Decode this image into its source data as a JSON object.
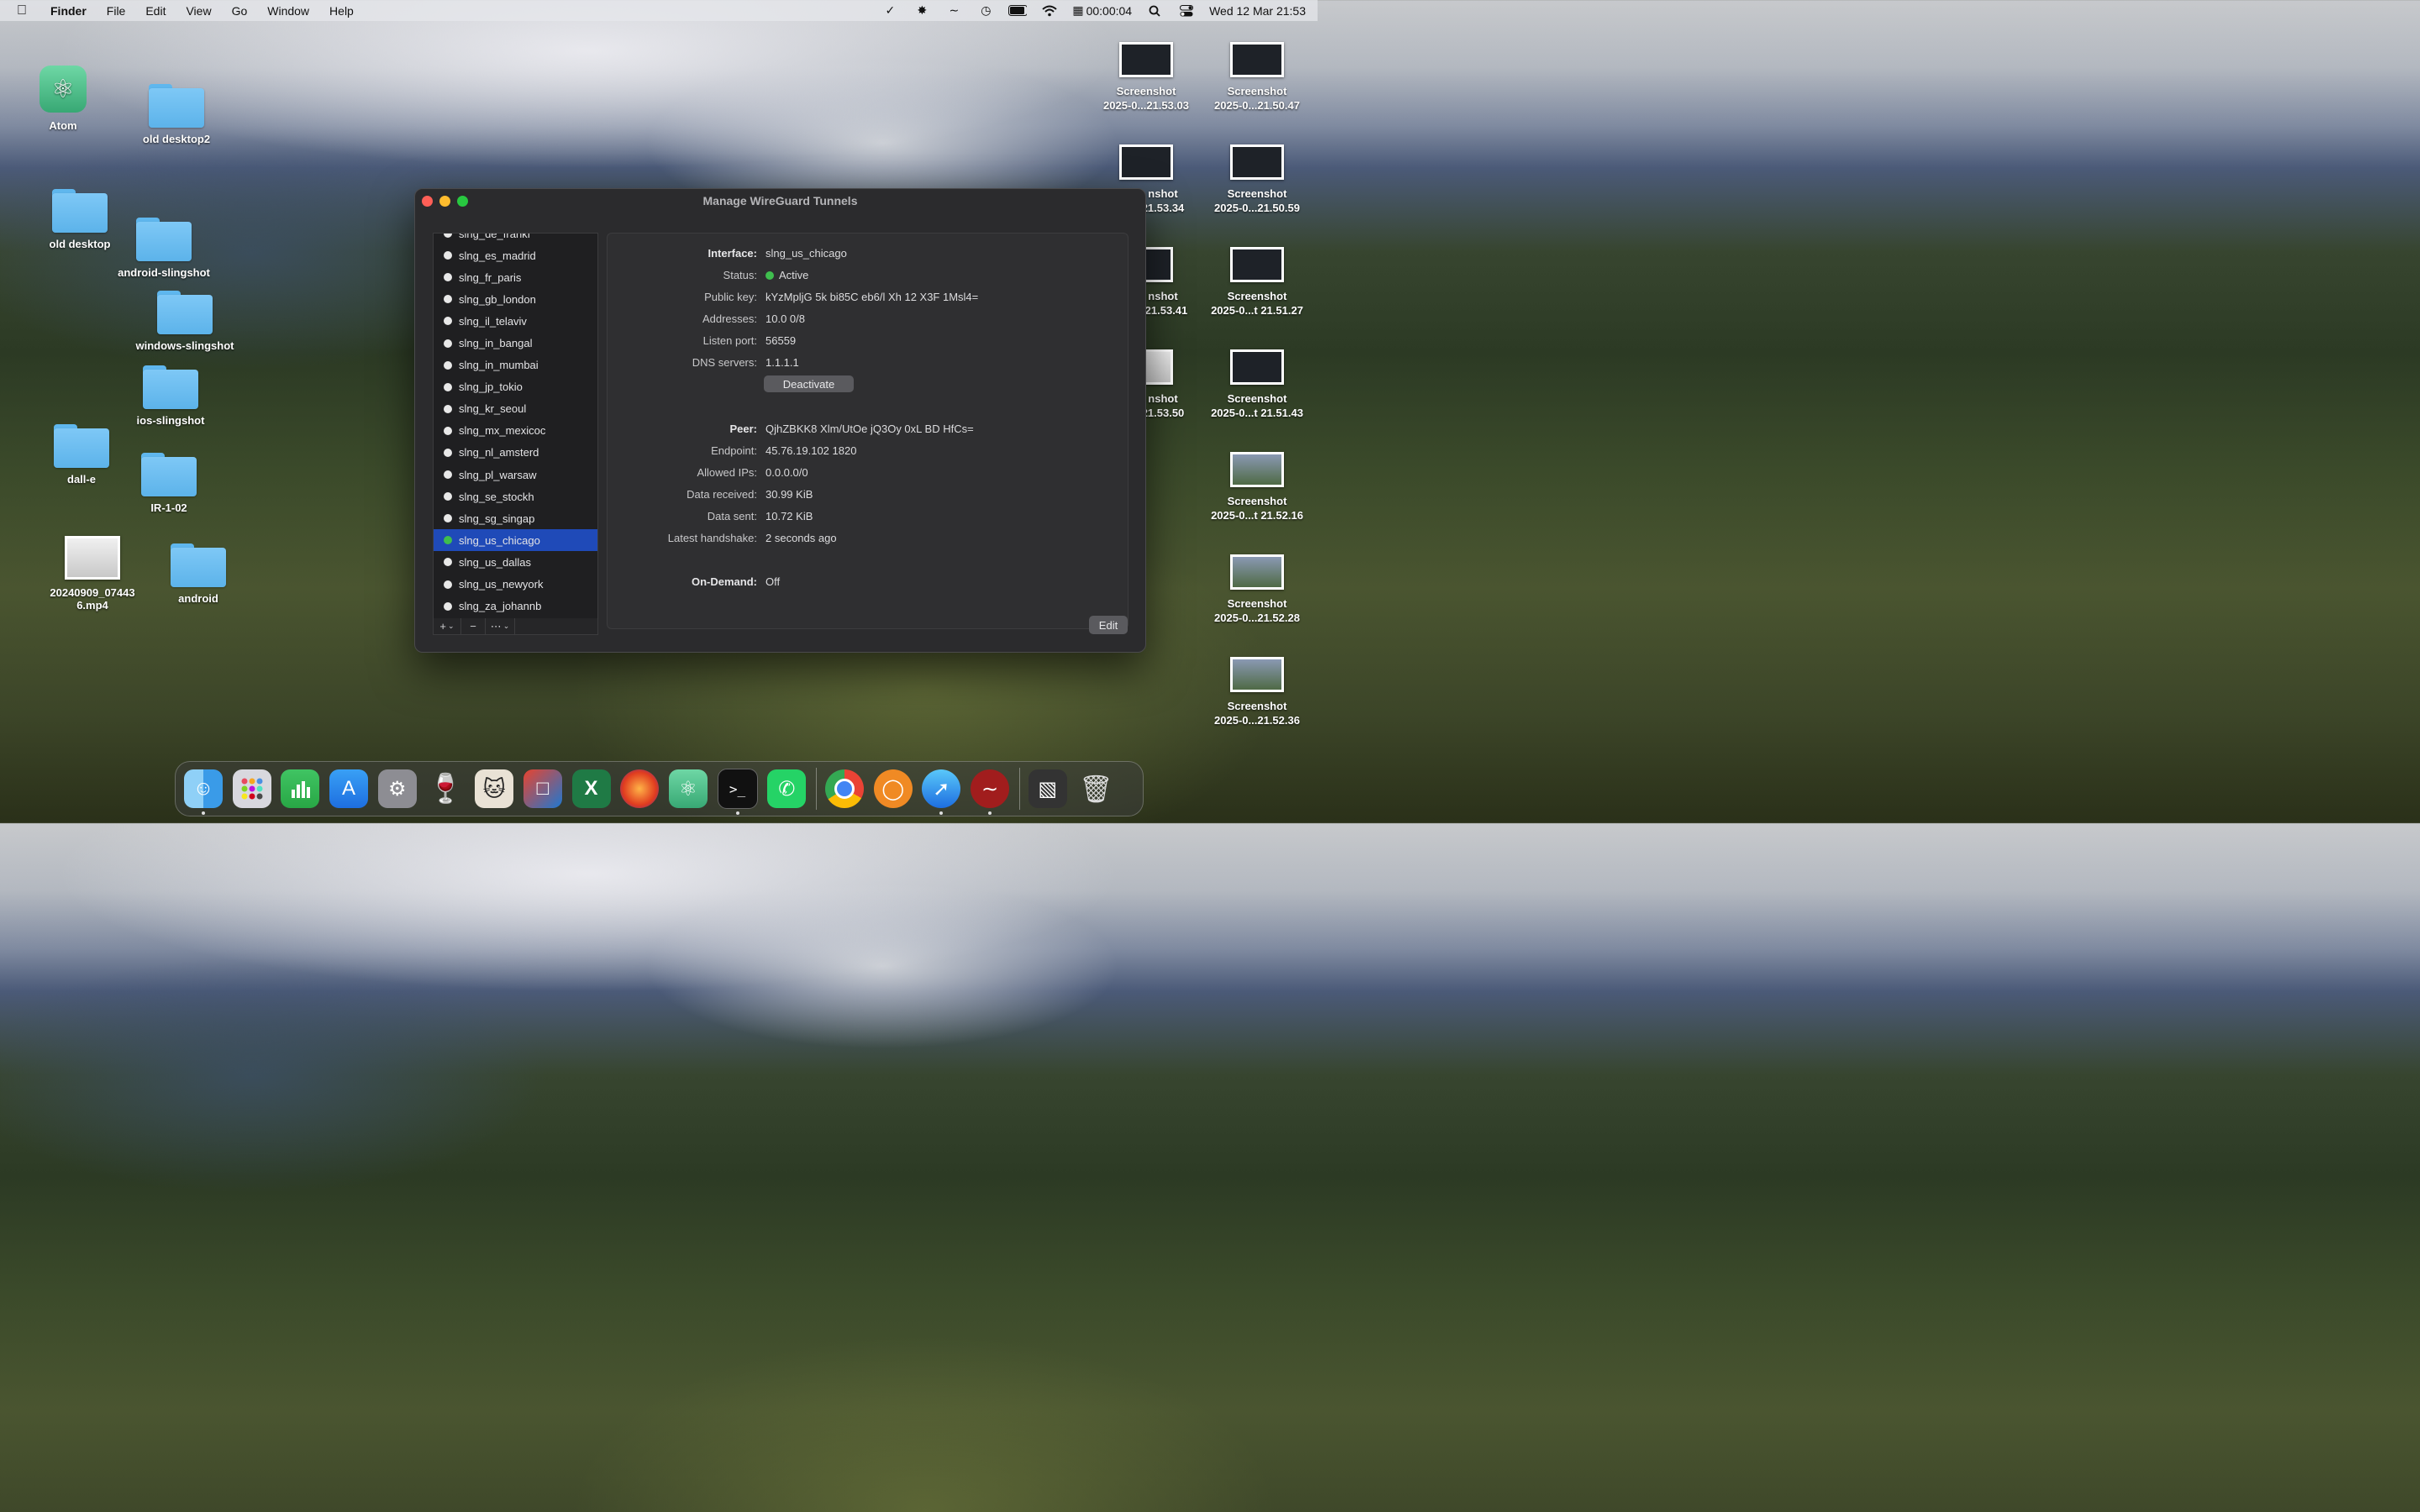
{
  "menubar": {
    "app_name": "Finder",
    "menus": [
      "File",
      "Edit",
      "View",
      "Go",
      "Window",
      "Help"
    ],
    "timer": "00:00:04",
    "datetime": "Wed 12 Mar  21:53"
  },
  "desktop": {
    "items": [
      {
        "label": "Atom",
        "kind": "app"
      },
      {
        "label": "old desktop2",
        "kind": "folder"
      },
      {
        "label": "old desktop",
        "kind": "folder"
      },
      {
        "label": "android-slingshot",
        "kind": "folder"
      },
      {
        "label": "windows-slingshot",
        "kind": "folder"
      },
      {
        "label": "ios-slingshot",
        "kind": "folder"
      },
      {
        "label": "dall-e",
        "kind": "folder"
      },
      {
        "label": "IR-1-02",
        "kind": "folder"
      },
      {
        "label": "20240909_07443",
        "label2": "6.mp4",
        "kind": "video"
      },
      {
        "label": "android",
        "kind": "folder"
      }
    ],
    "screenshots": [
      {
        "line1": "Screenshot",
        "line2": "2025-0...21.53.03"
      },
      {
        "line1": "Screenshot",
        "line2": "2025-0...21.50.47"
      },
      {
        "line1": "nshot",
        "line2": "21.53.34"
      },
      {
        "line1": "Screenshot",
        "line2": "2025-0...21.50.59"
      },
      {
        "line1": "nshot",
        "line2": "t 21.53.41"
      },
      {
        "line1": "Screenshot",
        "line2": "2025-0...t 21.51.27"
      },
      {
        "line1": "nshot",
        "line2": "21.53.50"
      },
      {
        "line1": "Screenshot",
        "line2": "2025-0...t 21.51.43"
      },
      {
        "line1": "Screenshot",
        "line2": "2025-0...t 21.52.16"
      },
      {
        "line1": "Screenshot",
        "line2": "2025-0...21.52.28"
      },
      {
        "line1": "Screenshot",
        "line2": "2025-0...21.52.36"
      }
    ]
  },
  "window": {
    "title": "Manage WireGuard Tunnels",
    "tunnels": [
      {
        "name": "slng_de_frankf",
        "active": false
      },
      {
        "name": "slng_es_madrid",
        "active": false
      },
      {
        "name": "slng_fr_paris",
        "active": false
      },
      {
        "name": "slng_gb_london",
        "active": false
      },
      {
        "name": "slng_il_telaviv",
        "active": false
      },
      {
        "name": "slng_in_bangal",
        "active": false
      },
      {
        "name": "slng_in_mumbai",
        "active": false
      },
      {
        "name": "slng_jp_tokio",
        "active": false
      },
      {
        "name": "slng_kr_seoul",
        "active": false
      },
      {
        "name": "slng_mx_mexicoc",
        "active": false
      },
      {
        "name": "slng_nl_amsterd",
        "active": false
      },
      {
        "name": "slng_pl_warsaw",
        "active": false
      },
      {
        "name": "slng_se_stockh",
        "active": false
      },
      {
        "name": "slng_sg_singap",
        "active": false
      },
      {
        "name": "slng_us_chicago",
        "active": true
      },
      {
        "name": "slng_us_dallas",
        "active": false
      },
      {
        "name": "slng_us_newyork",
        "active": false
      },
      {
        "name": "slng_za_johannb",
        "active": false
      }
    ],
    "toolbar": {
      "add": "+",
      "remove": "−",
      "more": "⋯"
    },
    "interface": {
      "interface_label": "Interface:",
      "interface_value": "slng_us_chicago",
      "status_label": "Status:",
      "status_value": "Active",
      "pubkey_label": "Public key:",
      "pubkey_value": "kYzMpljG  5k  bi85C  eb6/l  Xh  12  X3F  1Msl4=",
      "addresses_label": "Addresses:",
      "addresses_value": "10.0    0/8",
      "port_label": "Listen port:",
      "port_value": "56559",
      "dns_label": "DNS servers:",
      "dns_value": "1.1.1.1",
      "deactivate": "Deactivate"
    },
    "peer": {
      "peer_label": "Peer:",
      "peer_value": "QjhZBKK8  Xlm/UtOe  jQ3Oy  0xL  BD  HfCs=",
      "endpoint_label": "Endpoint:",
      "endpoint_value": "45.76.19.102  1820",
      "allowed_label": "Allowed IPs:",
      "allowed_value": "0.0.0.0/0",
      "received_label": "Data received:",
      "received_value": "30.99 KiB",
      "sent_label": "Data sent:",
      "sent_value": "10.72 KiB",
      "handshake_label": "Latest handshake:",
      "handshake_value": "2 seconds ago"
    },
    "ondemand_label": "On-Demand:",
    "ondemand_value": "Off",
    "edit": "Edit"
  }
}
